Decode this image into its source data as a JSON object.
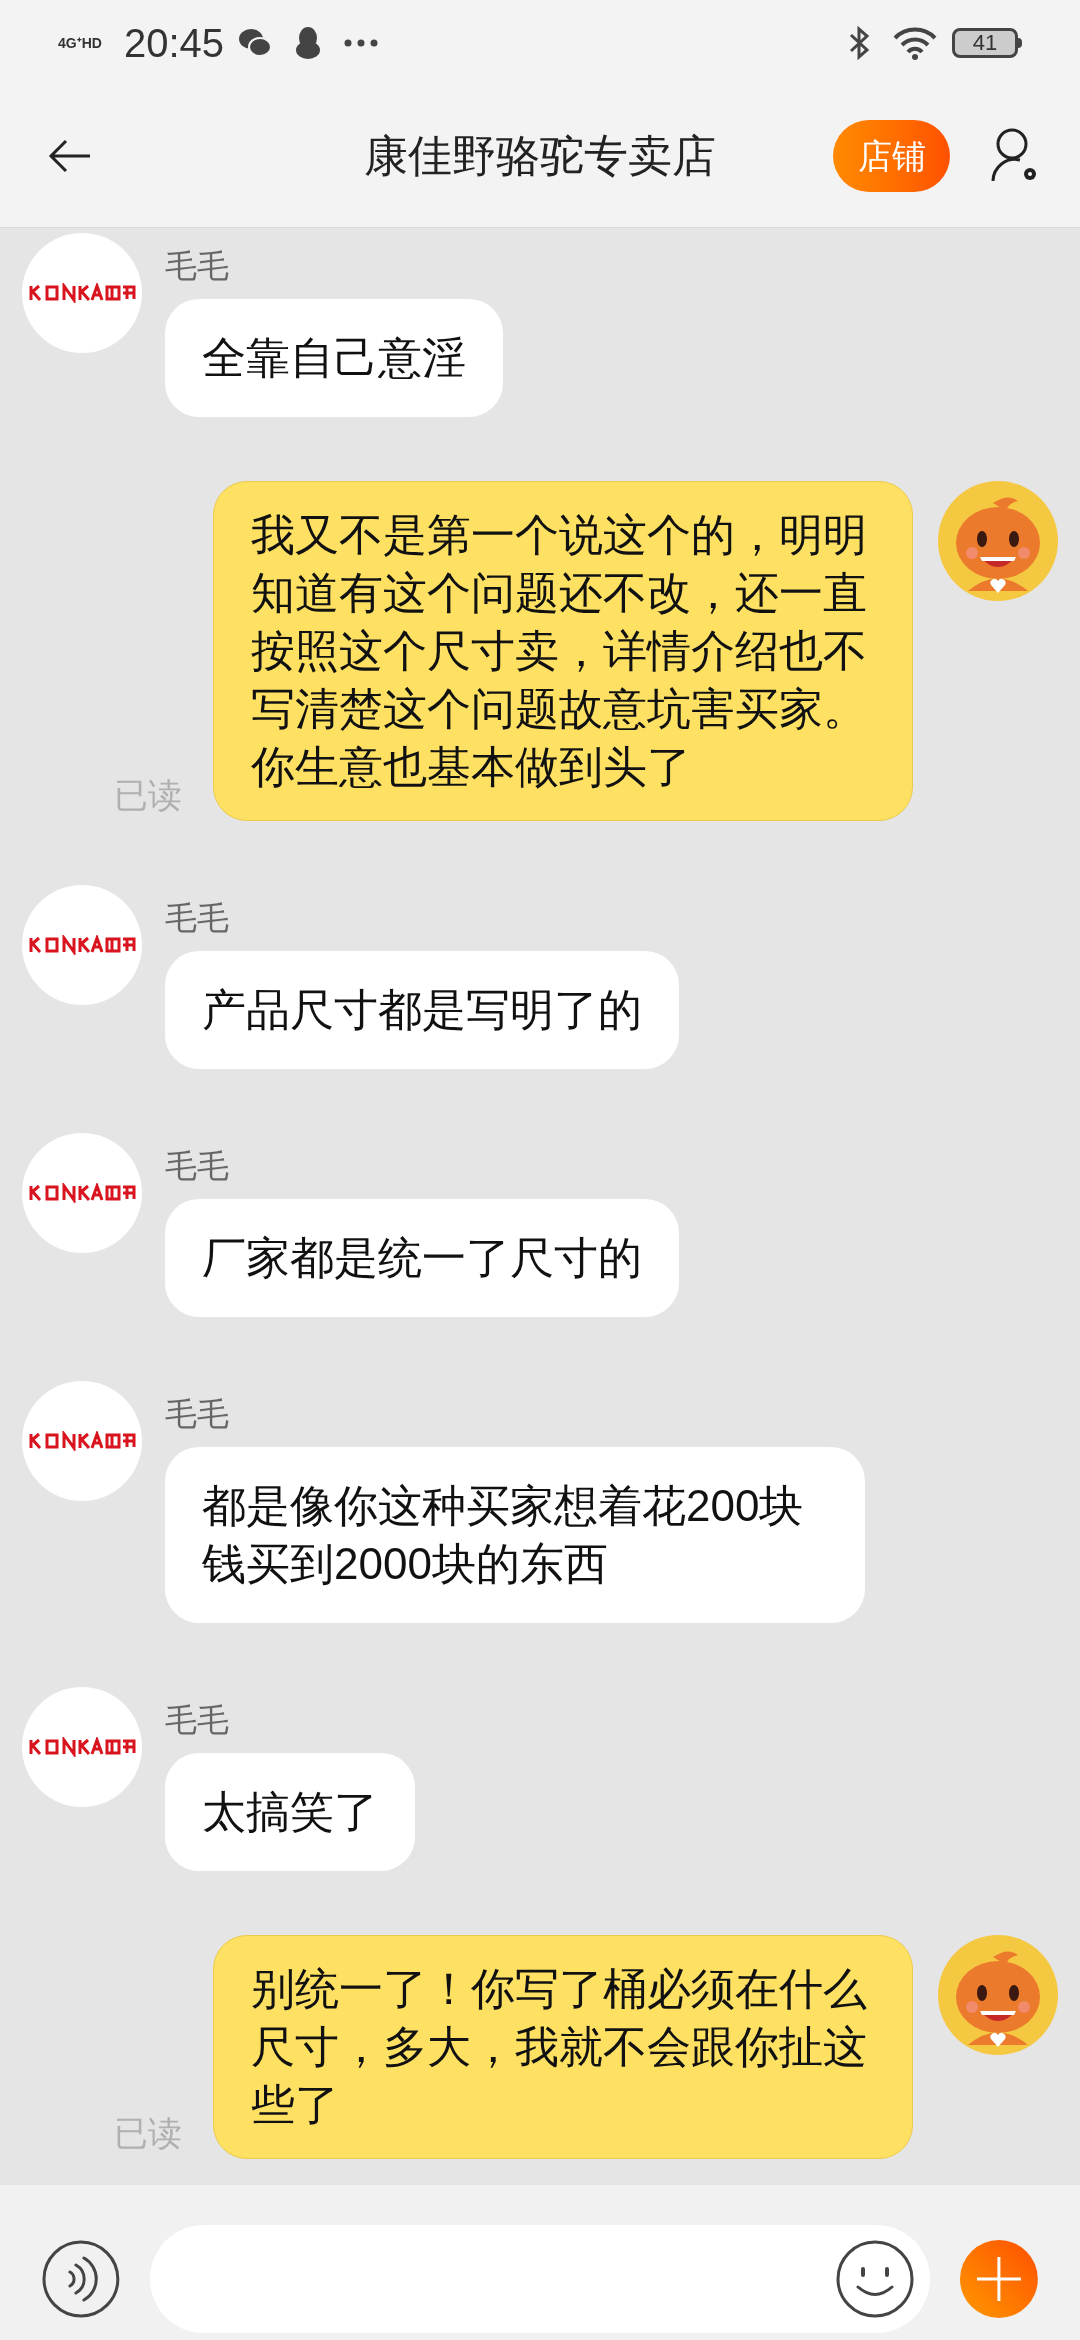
{
  "status_bar": {
    "network": "4G⁺HD",
    "time": "20:45",
    "battery": "41"
  },
  "header": {
    "title": "康佳野骆驼专卖店",
    "shop_button": "店铺"
  },
  "messages": [
    {
      "kind": "received",
      "name": "毛毛",
      "text": "全靠自己意淫"
    },
    {
      "kind": "sent",
      "text": "我又不是第一个说这个的，明明知道有这个问题还不改，还一直按照这个尺寸卖，详情介绍也不写清楚这个问题故意坑害买家。你生意也基本做到头了",
      "read": "已读"
    },
    {
      "kind": "received",
      "name": "毛毛",
      "text": "产品尺寸都是写明了的"
    },
    {
      "kind": "received",
      "name": "毛毛",
      "text": "厂家都是统一了尺寸的"
    },
    {
      "kind": "received",
      "name": "毛毛",
      "text": "都是像你这种买家想着花200块钱买到2000块的东西"
    },
    {
      "kind": "received",
      "name": "毛毛",
      "text": "太搞笑了"
    },
    {
      "kind": "sent",
      "text": "别统一了！你写了桶必须在什么尺寸，多大，我就不会跟你扯这些了",
      "read": "已读"
    }
  ]
}
